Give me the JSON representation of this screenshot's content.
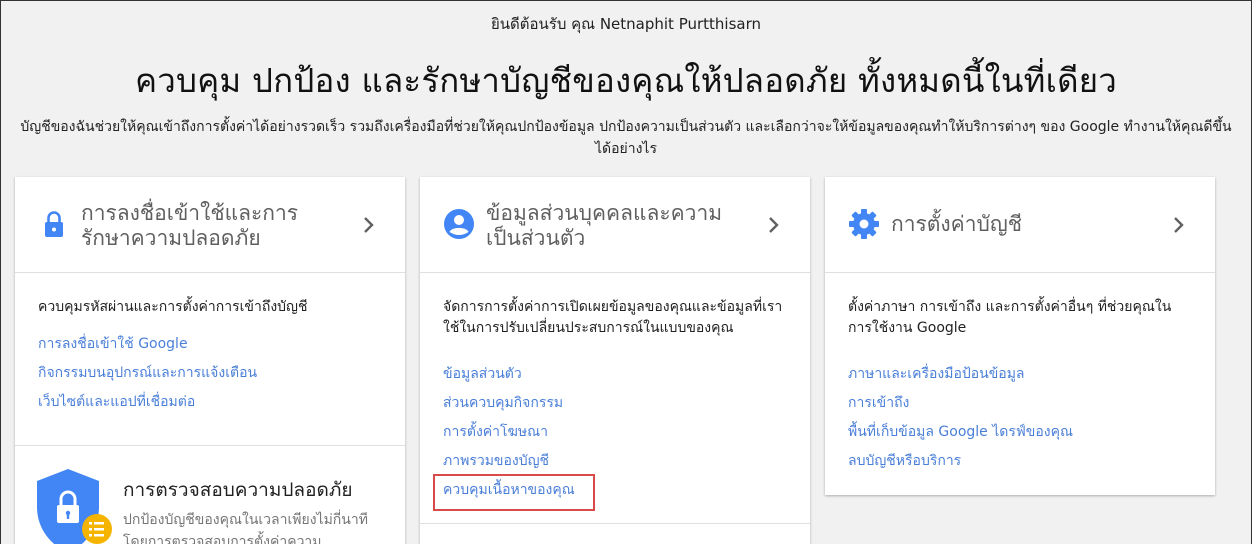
{
  "header": {
    "greeting": "ยินดีต้อนรับ คุณ Netnaphit Purtthisarn",
    "title": "ควบคุม ปกป้อง และรักษาบัญชีของคุณให้ปลอดภัย ทั้งหมดนี้ในที่เดียว",
    "description": "บัญชีของฉันช่วยให้คุณเข้าถึงการตั้งค่าได้อย่างรวดเร็ว รวมถึงเครื่องมือที่ช่วยให้คุณปกป้องข้อมูล ปกป้องความเป็นส่วนตัว และเลือกว่าจะให้ข้อมูลของคุณทำให้บริการต่างๆ ของ Google ทำงานให้คุณดีขึ้นได้อย่างไร"
  },
  "cards": [
    {
      "title": "การลงชื่อเข้าใช้และการรักษาความปลอดภัย",
      "icon": "lock-icon",
      "description": "ควบคุมรหัสผ่านและการตั้งค่าการเข้าถึงบัญชี",
      "links": [
        "การลงชื่อเข้าใช้ Google",
        "กิจกรรมบนอุปกรณ์และการแจ้งเตือน",
        "เว็บไซต์และแอปที่เชื่อมต่อ"
      ],
      "security_checkup": {
        "title": "การตรวจสอบความปลอดภัย",
        "description": "ปกป้องบัญชีของคุณในเวลาเพียงไม่กี่นาทีโดยการตรวจสอบการตั้งค่าความ"
      }
    },
    {
      "title": "ข้อมูลส่วนบุคคลและความเป็นส่วนตัว",
      "icon": "person-icon",
      "description": "จัดการการตั้งค่าการเปิดเผยข้อมูลของคุณและข้อมูลที่เราใช้ในการปรับเปลี่ยนประสบการณ์ในแบบของคุณ",
      "links": [
        "ข้อมูลส่วนตัว",
        "ส่วนควบคุมกิจกรรม",
        "การตั้งค่าโฆษณา",
        "ภาพรวมของบัญชี",
        "ควบคุมเนื้อหาของคุณ"
      ],
      "highlighted_link": "ควบคุมเนื้อหาของคุณ"
    },
    {
      "title": "การตั้งค่าบัญชี",
      "icon": "gear-icon",
      "description": "ตั้งค่าภาษา การเข้าถึง และการตั้งค่าอื่นๆ ที่ช่วยคุณในการใช้งาน Google",
      "links": [
        "ภาษาและเครื่องมือป้อนข้อมูล",
        "การเข้าถึง",
        "พื้นที่เก็บข้อมูล Google ไดรฟ์ของคุณ",
        "ลบบัญชีหรือบริการ"
      ]
    }
  ],
  "colors": {
    "link": "#4a7fd8",
    "icon_blue": "#4285f4",
    "highlight_border": "#d94a4a",
    "badge_yellow": "#f4b400"
  }
}
